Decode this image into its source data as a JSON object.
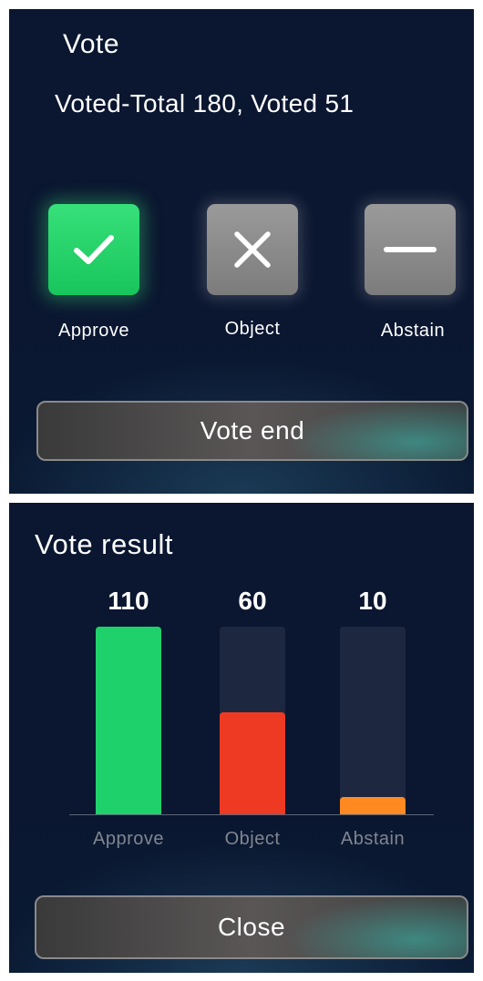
{
  "vote": {
    "title": "Vote",
    "status": "Voted-Total 180, Voted 51",
    "options": [
      {
        "label": "Approve",
        "icon": "check-icon",
        "color": "#22c55e",
        "selected": true
      },
      {
        "label": "Object",
        "icon": "close-icon",
        "color": "#8a8a8a",
        "selected": false
      },
      {
        "label": "Abstain",
        "icon": "minus-icon",
        "color": "#8a8a8a",
        "selected": false
      }
    ],
    "end_button": "Vote end"
  },
  "result": {
    "title": "Vote result",
    "close_button": "Close"
  },
  "chart_data": {
    "type": "bar",
    "categories": [
      "Approve",
      "Object",
      "Abstain"
    ],
    "values": [
      110,
      60,
      10
    ],
    "colors": [
      "#1fd16a",
      "#ee3a22",
      "#ff8a22"
    ],
    "ylim": [
      0,
      110
    ],
    "grid": false
  }
}
